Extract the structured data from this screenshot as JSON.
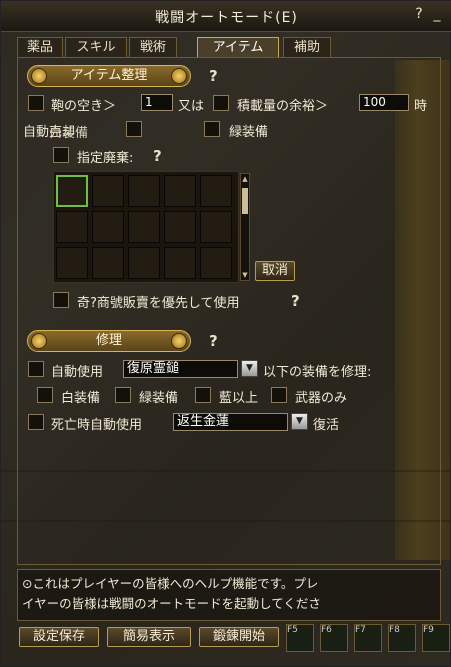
{
  "window": {
    "title": "戦闘オートモード(E)",
    "help_glyph": "?",
    "minimize_glyph": "_"
  },
  "tabs": [
    {
      "label": "薬品"
    },
    {
      "label": "スキル"
    },
    {
      "label": "戦術"
    },
    {
      "label": "アイテム",
      "active": true
    },
    {
      "label": "補助"
    }
  ],
  "item_section": {
    "title": "アイテム整理",
    "help": "?",
    "bag_label_a": "鞄の空き＞",
    "bag_value": "1",
    "bag_label_b": "又は",
    "weight_label": "積載量の余裕＞",
    "weight_value": "100",
    "weight_unit": "時",
    "auto_label": "自動売却",
    "white_equip": "白装備",
    "green_equip": "緑装備",
    "discard_label": "指定廃棄:",
    "discard_help": "?",
    "cancel_button": "取消",
    "priority_label": "奇?商號販賣を優先して使用",
    "priority_help": "?"
  },
  "repair_section": {
    "title": "修理",
    "help": "?",
    "auto_use": "自動使用",
    "repair_item": "復原霊鎚",
    "repair_suffix": "以下の装備を修理:",
    "white": "白装備",
    "green": "緑装備",
    "blue": "藍以上",
    "weapon_only": "武器のみ",
    "death_auto_use": "死亡時自動使用",
    "revive_item": "返生金蓮",
    "revive_suffix": "復活"
  },
  "help_text": {
    "line1": "⊙これはプレイヤーの皆様へのヘルプ機能です。プレ",
    "line2": "イヤーの皆様は戦闘のオートモードを起動してくださ"
  },
  "buttons": {
    "save": "設定保存",
    "simple": "簡易表示",
    "start": "鍛錬開始"
  },
  "hotkeys": [
    "F5",
    "F6",
    "F7",
    "F8",
    "F9"
  ],
  "colors": {
    "accent": "#c8aa5a",
    "selected_slot": "#6cc04a"
  }
}
